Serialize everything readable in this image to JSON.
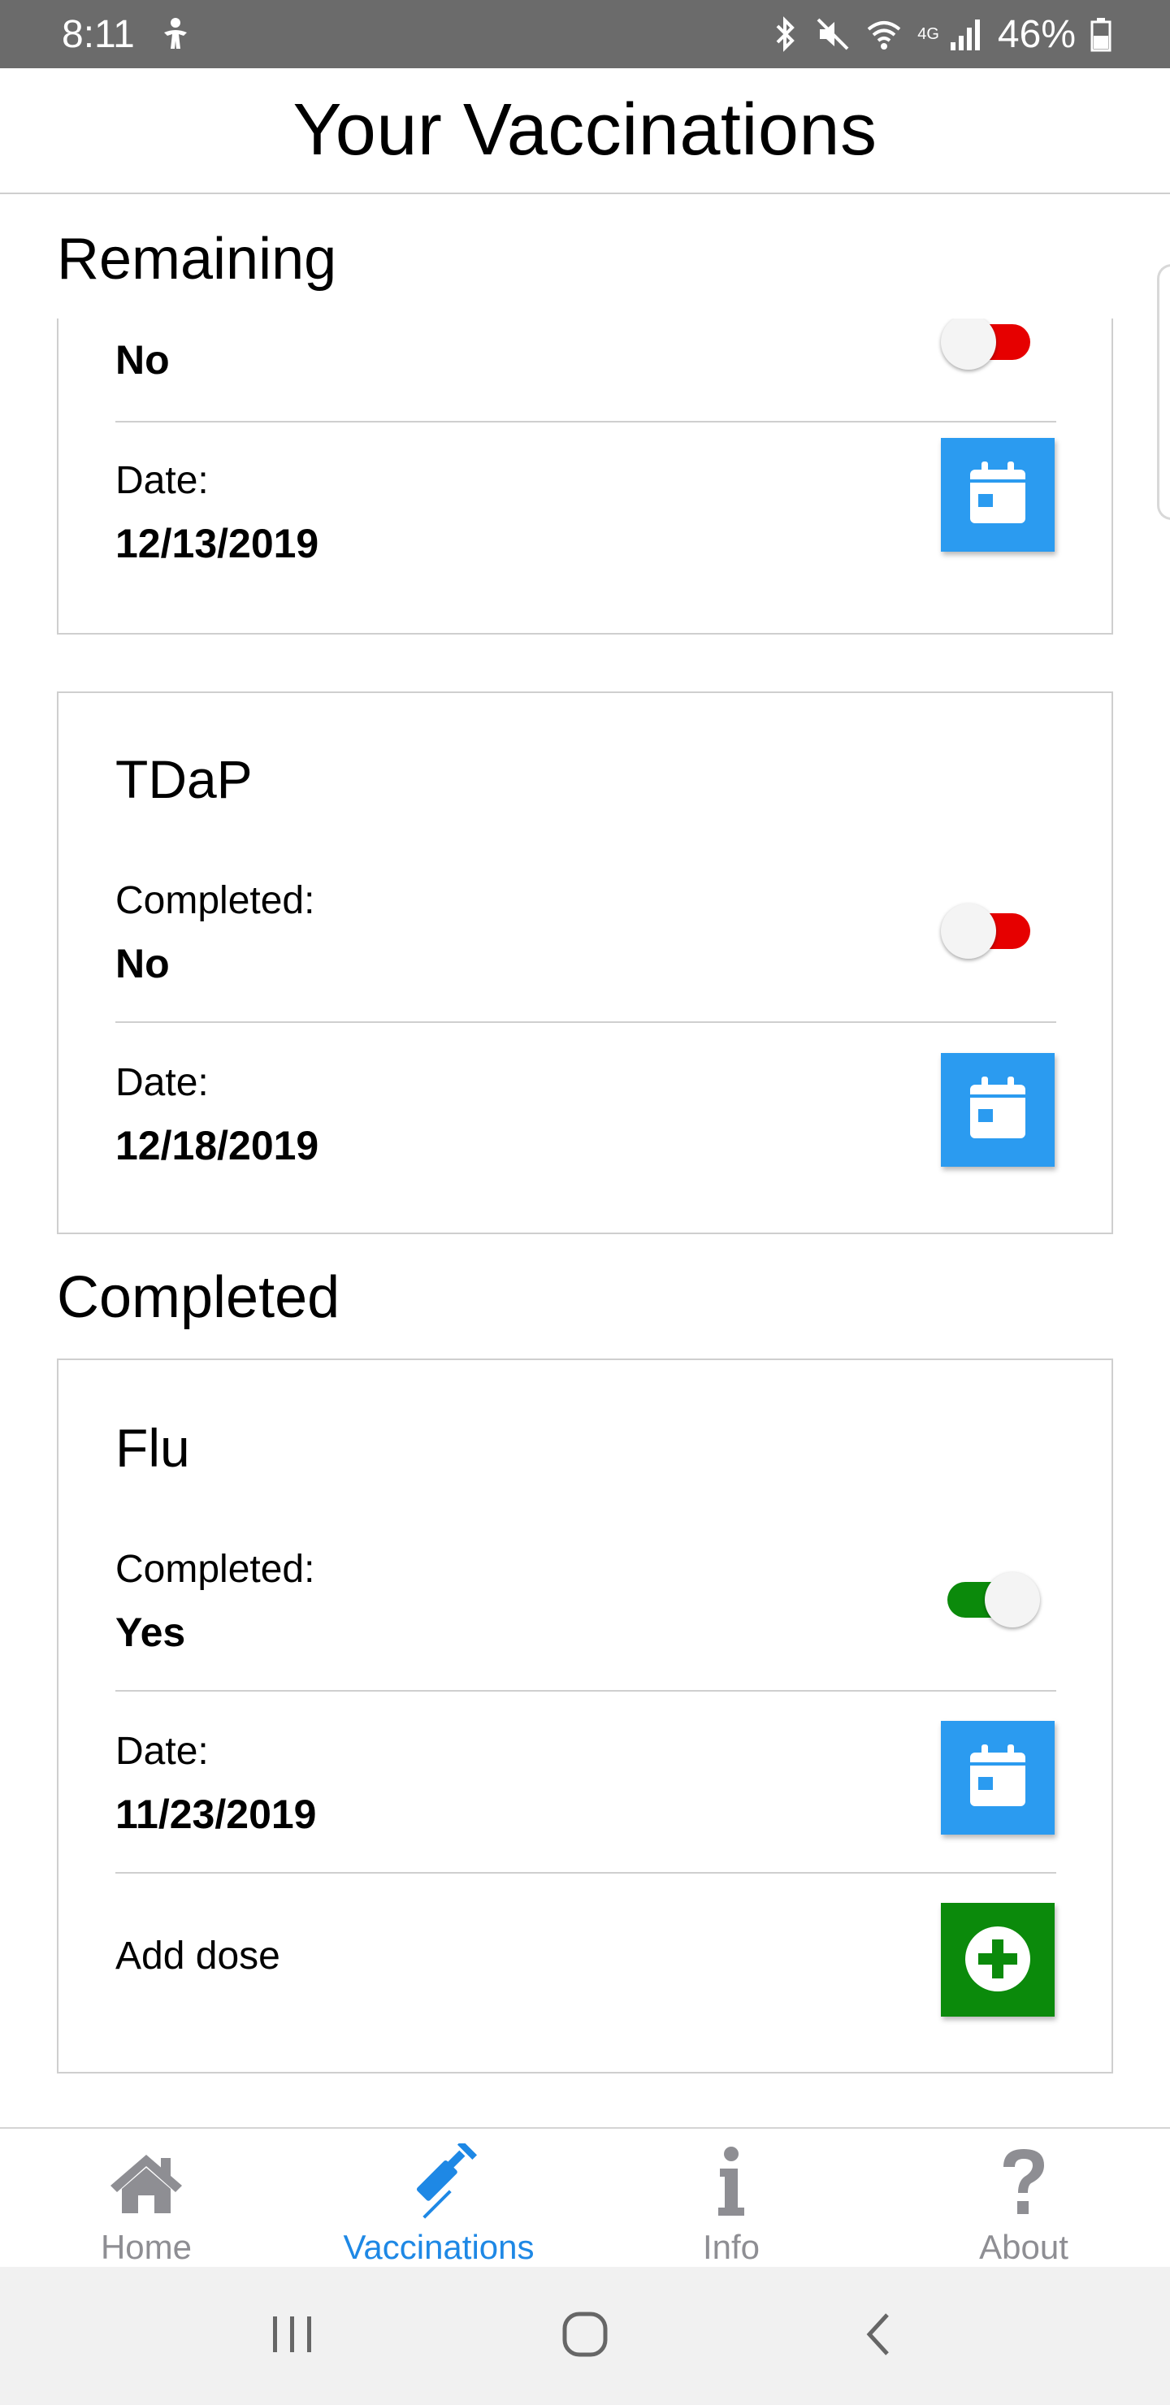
{
  "status_bar": {
    "time": "8:11",
    "network": "4G",
    "battery": "46%"
  },
  "header": {
    "title": "Your Vaccinations"
  },
  "sections": {
    "remaining_title": "Remaining",
    "completed_title": "Completed"
  },
  "remaining": [
    {
      "completed_value": "No",
      "completed_state": "off",
      "date_label": "Date:",
      "date_value": "12/13/2019"
    },
    {
      "name": "TDaP",
      "completed_label": "Completed:",
      "completed_value": "No",
      "completed_state": "off",
      "date_label": "Date:",
      "date_value": "12/18/2019"
    }
  ],
  "completed": [
    {
      "name": "Flu",
      "completed_label": "Completed:",
      "completed_value": "Yes",
      "completed_state": "on",
      "date_label": "Date:",
      "date_value": "11/23/2019",
      "add_dose_label": "Add dose"
    }
  ],
  "tabs": [
    {
      "label": "Home",
      "icon": "home-icon",
      "active": false
    },
    {
      "label": "Vaccinations",
      "icon": "syringe-icon",
      "active": true
    },
    {
      "label": "Info",
      "icon": "info-icon",
      "active": false
    },
    {
      "label": "About",
      "icon": "question-icon",
      "active": false
    }
  ],
  "colors": {
    "accent_blue": "#1e88e5",
    "calendar_button": "#2b9bf0",
    "add_button": "#0b8a0b",
    "toggle_off": "#e60000",
    "toggle_on": "#0b8a0b",
    "status_bar": "#6b6b6b"
  }
}
